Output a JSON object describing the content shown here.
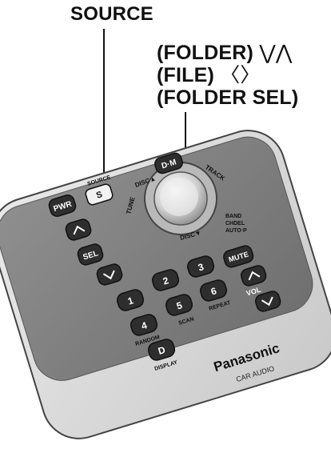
{
  "callouts": {
    "source": "SOURCE",
    "folder": "(FOLDER)",
    "folder_glyphs": "⋁⋀",
    "file": "(FILE)",
    "file_glyphs": "〈〉",
    "folder_sel": "(FOLDER SEL)"
  },
  "remote": {
    "brand": "Panasonic",
    "model_label": "CAR AUDIO",
    "buttons": {
      "pwr": "PWR",
      "source_label": "SOURCE",
      "source_key": "S",
      "dm": "D·M",
      "sel": "SEL",
      "mute": "MUTE",
      "vol": "VOL",
      "d": "D"
    },
    "numbers": [
      "1",
      "2",
      "3",
      "4",
      "5",
      "6"
    ],
    "labels": {
      "disc_up": "DISC▲",
      "track": "TRACK",
      "tune": "TUNE",
      "disc_down": "DISC▼",
      "band": "BAND",
      "chdel": "CHDEL",
      "auto": "AUTO·P",
      "random": "RANDOM",
      "scan": "SCAN",
      "repeat": "REPEAT",
      "display": "DISPLAY"
    }
  }
}
